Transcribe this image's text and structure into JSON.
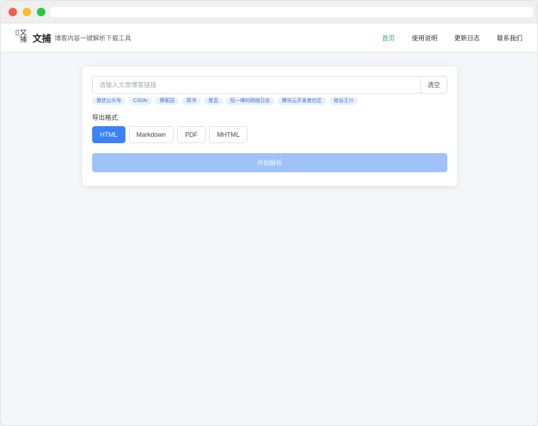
{
  "site": {
    "logo_alt": "文捕",
    "brand": "文捕",
    "tagline": "博客内容一键解析下载工具"
  },
  "nav": [
    {
      "label": "首页",
      "active": true
    },
    {
      "label": "使用说明",
      "active": false
    },
    {
      "label": "更新日志",
      "active": false
    },
    {
      "label": "联系我们",
      "active": false
    }
  ],
  "form": {
    "url_placeholder": "请输入文章博客链接",
    "clear_label": "清空",
    "sources": [
      "微信公众号",
      "CSDN",
      "博客园",
      "简书",
      "思否",
      "阮一峰的网络日志",
      "腾讯云开发者社区",
      "硅谷王川"
    ],
    "format_label": "导出格式",
    "formats": [
      {
        "label": "HTML",
        "selected": true
      },
      {
        "label": "Markdown",
        "selected": false
      },
      {
        "label": "PDF",
        "selected": false
      },
      {
        "label": "MHTML",
        "selected": false
      }
    ],
    "start_label": "开始解析"
  },
  "colors": {
    "accent": "#3b82f6",
    "nav_active": "#2aa56b",
    "disabled_button": "#a0c2fa",
    "tag_bg": "#e8f0fd",
    "tag_text": "#3f72c4"
  }
}
